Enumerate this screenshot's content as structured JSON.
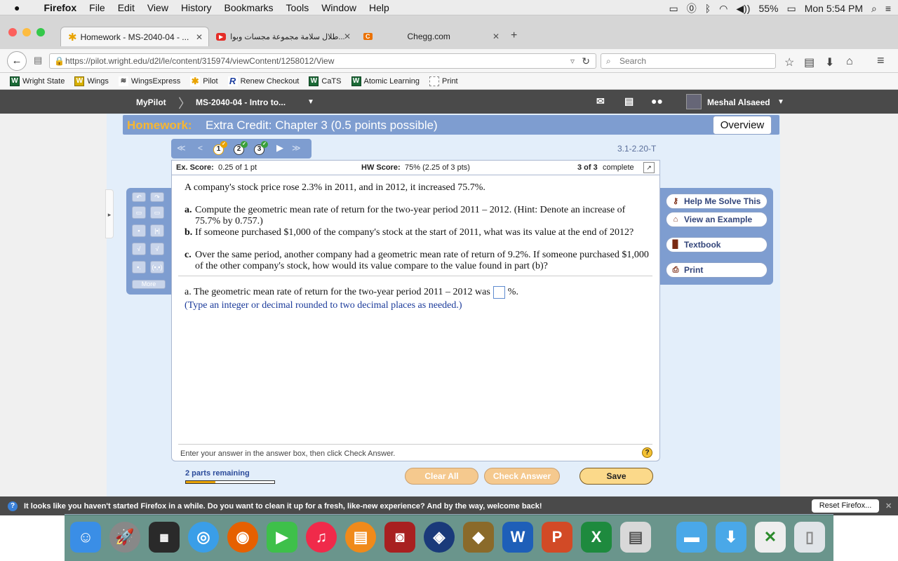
{
  "menubar": {
    "app": "Firefox",
    "items": [
      "File",
      "Edit",
      "View",
      "History",
      "Bookmarks",
      "Tools",
      "Window",
      "Help"
    ],
    "battery": "55%",
    "clock": "Mon 5:54 PM"
  },
  "tabs": [
    {
      "label": "Homework - MS-2040-04 - ...",
      "active": true
    },
    {
      "label": "طلال سلامة مجموعة مجسات وبوا...",
      "active": false
    },
    {
      "label": "Chegg.com",
      "active": false
    }
  ],
  "navbar": {
    "url": "https://pilot.wright.edu/d2l/le/content/315974/viewContent/1258012/View",
    "search_placeholder": "Search"
  },
  "bookmarks": [
    "Wright State",
    "Wings",
    "WingsExpress",
    "Pilot",
    "Renew Checkout",
    "CaTS",
    "Atomic Learning",
    "Print"
  ],
  "d2l": {
    "home": "MyPilot",
    "course": "MS-2040-04 - Intro to...",
    "user": "Meshal Alsaeed"
  },
  "homework": {
    "label": "Homework:",
    "title": "Extra Credit: Chapter 3 (0.5 points possible)",
    "overview": "Overview",
    "question_id": "3.1-2.20-T",
    "questions": [
      "1",
      "2",
      "3"
    ],
    "ex_score_label": "Ex. Score:",
    "ex_score": "0.25 of 1 pt",
    "hw_score_label": "HW Score:",
    "hw_score": "75% (2.25 of 3 pts)",
    "complete_count": "3 of 3",
    "complete_word": "complete",
    "intro": "A company's stock price rose 2.3% in 2011, and in 2012, it increased 75.7%.",
    "part_a_label": "a.",
    "part_a": "Compute the geometric mean rate of return for the two-year period 2011 – 2012. (Hint: Denote an increase of 75.7% by 0.757.)",
    "part_b_label": "b.",
    "part_b": "If someone purchased $1,000 of the company's stock at the start of 2011, what was its value at the end of 2012?",
    "part_c_label": "c.",
    "part_c": "Over the same period, another company had a geometric mean rate of return of 9.2%. If someone purchased $1,000 of the other company's stock, how would its value compare to the value found in part (b)?",
    "answer_prefix": "a. The geometric mean rate of return for the two-year period 2011 – 2012 was",
    "answer_suffix": "%.",
    "instruction": "(Type an integer or decimal rounded to two decimal places as needed.)",
    "footer_hint": "Enter your answer in the answer box, then click Check Answer.",
    "parts_remaining": "2 parts remaining",
    "parts_progress": 0.33,
    "more": "More"
  },
  "help_buttons": [
    "Help Me Solve This",
    "View an Example",
    "Textbook",
    "Print"
  ],
  "actions": {
    "clear": "Clear All",
    "check": "Check Answer",
    "save": "Save"
  },
  "notify": {
    "text": "It looks like you haven't started Firefox in a while. Do you want to clean it up for a fresh, like-new experience? And by the way, welcome back!",
    "button": "Reset Firefox..."
  },
  "dock_icons": [
    "finder-icon",
    "launchpad-icon",
    "dashboard-icon",
    "safari-icon",
    "firefox-icon",
    "facetime-icon",
    "itunes-icon",
    "ibooks-icon",
    "photo-booth-icon",
    "steam-icon",
    "snow-leopard-icon",
    "word-icon",
    "powerpoint-icon",
    "excel-icon",
    "preview-icon",
    "folder-icon",
    "downloads-icon",
    "screenshot-icon",
    "trash-icon"
  ],
  "colors": {
    "accent": "#7e9dd0",
    "homework_label": "#f6b632",
    "save_button": "#fbd98a"
  }
}
